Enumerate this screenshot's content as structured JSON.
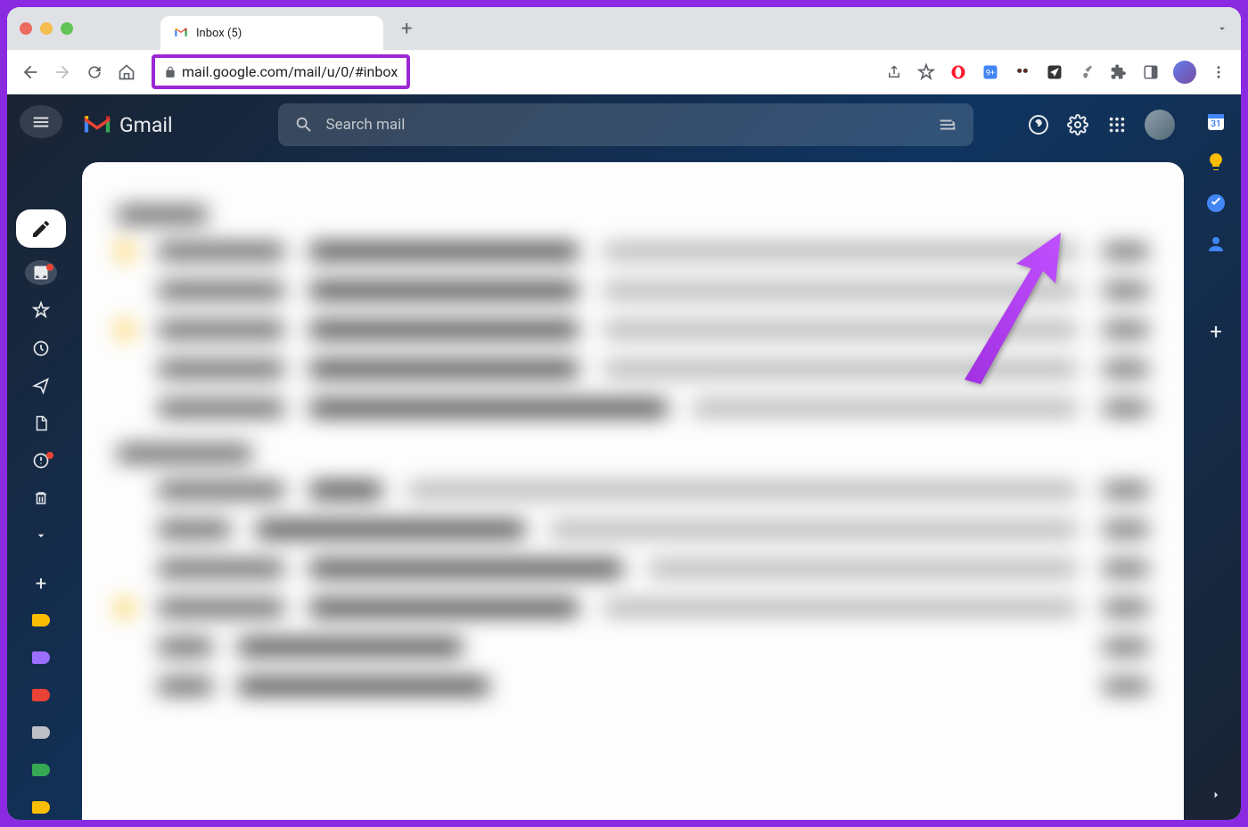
{
  "browser": {
    "tab": {
      "title": "Inbox (5)"
    },
    "url": "mail.google.com/mail/u/0/#inbox"
  },
  "gmail": {
    "logo_text": "Gmail",
    "search": {
      "placeholder": "Search mail"
    },
    "sidebar_labels": [
      {
        "color": "#fbbc04"
      },
      {
        "color": "#9c6eff"
      },
      {
        "color": "#ea4335"
      },
      {
        "color": "#bdc1c6"
      },
      {
        "color": "#34a853"
      },
      {
        "color": "#fbbc04"
      }
    ]
  },
  "annotation": {
    "highlight_color": "#9c27d4",
    "arrow_color": "#9c27d4",
    "target": "settings-icon"
  }
}
